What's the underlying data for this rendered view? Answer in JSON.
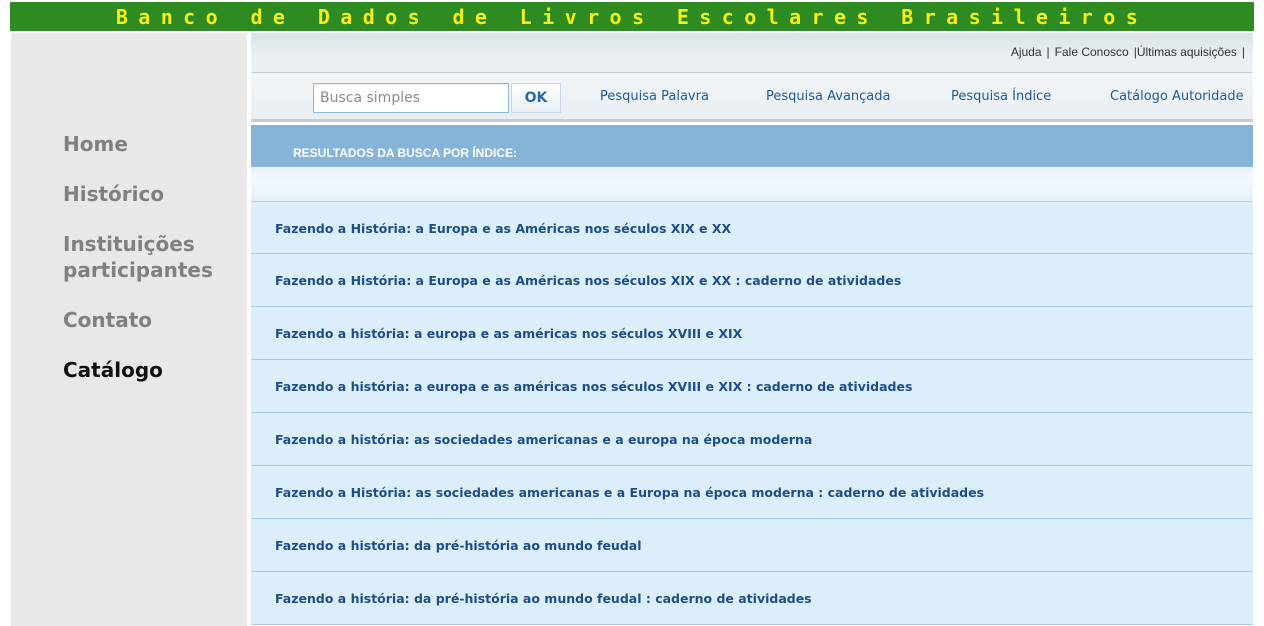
{
  "header": {
    "site_title": "Banco de Dados de Livros Escolares Brasileiros"
  },
  "sidebar": {
    "items": [
      {
        "label": "Home",
        "active": false
      },
      {
        "label": "Histórico",
        "active": false
      },
      {
        "label": "Instituições participantes",
        "active": false
      },
      {
        "label": "Contato",
        "active": false
      },
      {
        "label": "Catálogo",
        "active": true
      }
    ]
  },
  "utility_links": {
    "help": "Ajuda",
    "contact": "Fale Conosco",
    "latest": "Últimas aquisições",
    "separator": "|"
  },
  "search": {
    "placeholder": "Busca simples",
    "value": "",
    "ok_label": "OK",
    "links": [
      "Pesquisa Palavra",
      "Pesquisa Avançada",
      "Pesquisa Índice",
      "Catálogo Autoridade"
    ]
  },
  "results": {
    "title": "RESULTADOS DA BUSCA POR ÍNDICE:",
    "items": [
      "Fazendo a História: a Europa e as Américas nos séculos XIX e XX",
      "Fazendo a História: a Europa e as Américas nos séculos XIX e XX : caderno de atividades",
      "Fazendo a história: a europa e as américas nos séculos XVIII e XIX",
      "Fazendo a história: a europa e as américas nos séculos XVIII e XIX : caderno de atividades",
      "Fazendo a história: as sociedades americanas e a europa na época moderna",
      "Fazendo a História: as sociedades americanas e a Europa na época moderna : caderno de atividades",
      "Fazendo a história: da pré-história ao mundo feudal",
      "Fazendo a história: da pré-história ao mundo feudal : caderno de atividades"
    ]
  },
  "colors": {
    "title_bar": "#2e8b22",
    "title_text": "#f5ee1a",
    "sidebar_bg": "#e8e8e8",
    "results_header": "#86b4d8",
    "result_row_bg": "#ddeefb",
    "link": "#1c4f8a"
  }
}
